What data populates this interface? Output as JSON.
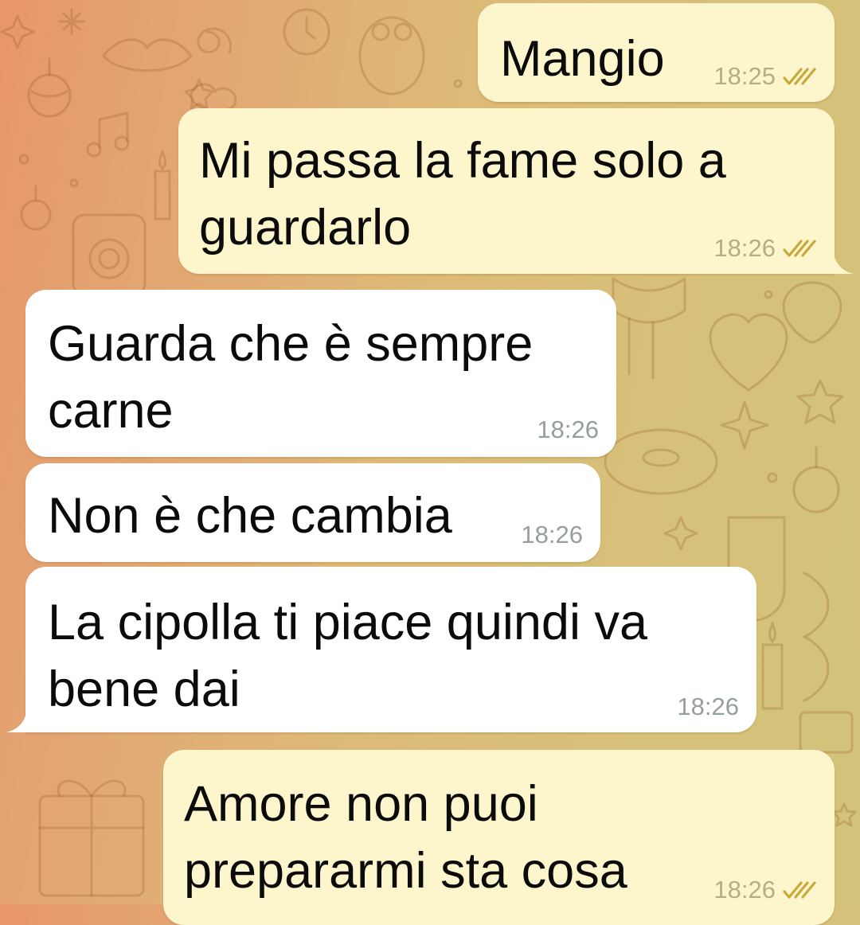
{
  "chat": {
    "messages": [
      {
        "direction": "outgoing",
        "lines": [
          "Mangio"
        ],
        "time": "18:25",
        "read_status": "double-check-icon"
      },
      {
        "direction": "outgoing",
        "lines": [
          "Mi passa la fame solo a",
          "guardarlo"
        ],
        "time": "18:26",
        "read_status": "double-check-icon"
      },
      {
        "direction": "incoming",
        "lines": [
          "Guarda che è sempre",
          "carne"
        ],
        "time": "18:26"
      },
      {
        "direction": "incoming",
        "lines": [
          "Non è che cambia"
        ],
        "time": "18:26"
      },
      {
        "direction": "incoming",
        "lines": [
          "La cipolla ti piace quindi va",
          "bene dai"
        ],
        "time": "18:26"
      },
      {
        "direction": "outgoing",
        "lines": [
          "Amore non puoi",
          "prepararmi sta cosa"
        ],
        "time": "18:26",
        "read_status": "double-check-icon"
      }
    ]
  },
  "colors": {
    "outgoing_bubble": "#fdf6cc",
    "incoming_bubble": "#ffffff",
    "read_ticks": "#c9a83c",
    "wallpaper_start": "#e8966a",
    "wallpaper_end": "#d2c27a"
  }
}
